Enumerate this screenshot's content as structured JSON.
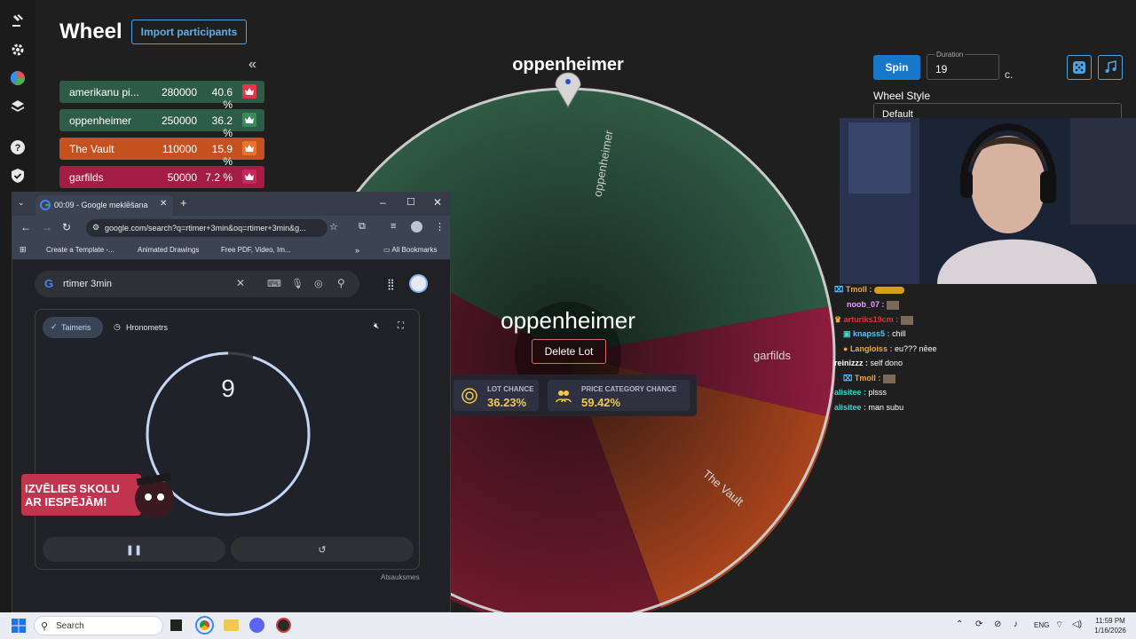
{
  "header": {
    "title": "Wheel",
    "import_label": "Import participants",
    "collapse_icon": "double-chevron-left-icon"
  },
  "lots": [
    {
      "name": "amerikanu pi...",
      "amount": "280000",
      "percent": "40.6 %",
      "color": "#2e5b45"
    },
    {
      "name": "oppenheimer",
      "amount": "250000",
      "percent": "36.2 %",
      "color": "#2d5c49"
    },
    {
      "name": "The Vault",
      "amount": "110000",
      "percent": "15.9 %",
      "color": "#c4511e"
    },
    {
      "name": "garfilds",
      "amount": "50000",
      "percent": "7.2 %",
      "color": "#a31d45"
    }
  ],
  "wheel": {
    "winner_title": "oppenheimer",
    "center_name": "oppenheimer",
    "delete_label": "Delete Lot",
    "segment_labels": {
      "oppenheimer": "oppenheimer",
      "garfilds": "garfilds",
      "vault": "The Vault"
    },
    "lot_chance_label": "LOT CHANCE",
    "lot_chance_value": "36.23%",
    "price_chance_label": "PRICE CATEGORY CHANCE",
    "price_chance_value": "59.42%"
  },
  "controls": {
    "spin_label": "Spin",
    "duration_label": "Duration",
    "duration_value": "19",
    "duration_unit": "c.",
    "wheel_style_label": "Wheel Style",
    "wheel_style_value": "Default"
  },
  "chat": [
    {
      "user": "Tmoll :",
      "msg": "",
      "color": "#f3a53b"
    },
    {
      "user": "noob_07 :",
      "msg": "",
      "color": "#e9a0ff"
    },
    {
      "user": "arturiks19cm :",
      "msg": "",
      "color": "#d23b3b"
    },
    {
      "user": "knapss5 :",
      "msg": "chill",
      "color": "#5cc0ff"
    },
    {
      "user": "Langloiss :",
      "msg": "eu??? nēee",
      "color": "#f3a53b"
    },
    {
      "user": "reinizzz :",
      "msg": "self dono",
      "color": "#ffffff"
    },
    {
      "user": "Tmoll :",
      "msg": "",
      "color": "#f3a53b"
    },
    {
      "user": "alisitee :",
      "msg": "plsss",
      "color": "#3bd6c6"
    },
    {
      "user": "alisitee :",
      "msg": "man subu",
      "color": "#3bd6c6"
    }
  ],
  "browser": {
    "tab_title": "00:09 - Google meklēšana",
    "url": "google.com/search?q=rtimer+3min&oq=rtimer+3min&g...",
    "bookmarks": [
      "Create a Template -...",
      "Animated Drawings",
      "Free PDF, Video, Im..."
    ],
    "all_bookmarks": "All Bookmarks",
    "search_query": "rtimer 3min",
    "tab_timer": "Taimeris",
    "tab_stopwatch": "Hronometrs",
    "timer_value": "9",
    "timer_progress": 0.95,
    "feedback": "Atsauksmes",
    "promo_line1": "IZVĒLIES SKOLU",
    "promo_line2": "AR IESPĒJĀM!"
  },
  "taskbar": {
    "search_placeholder": "Search",
    "language": "ENG",
    "time": "11:59 PM",
    "date": "1/16/2026"
  }
}
